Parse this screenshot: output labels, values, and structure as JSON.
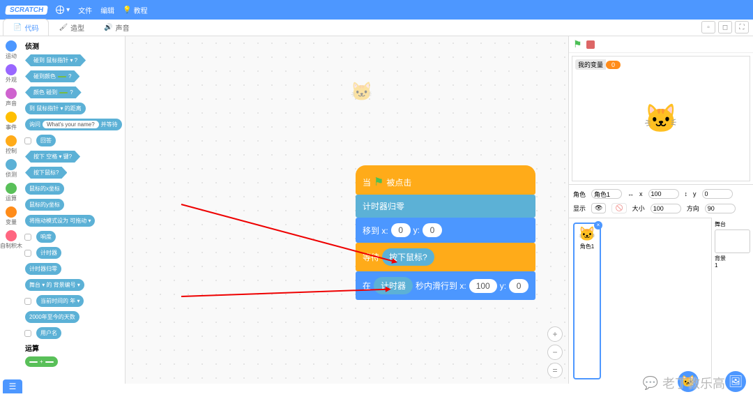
{
  "menu": {
    "file": "文件",
    "edit": "编辑",
    "tutorial": "教程",
    "lang_icon": "globe",
    "bulb": "💡"
  },
  "tabs": {
    "code": "代码",
    "costume": "造型",
    "sound": "声音"
  },
  "categories": [
    {
      "name": "运动",
      "color": "#4c97ff"
    },
    {
      "name": "外观",
      "color": "#9966ff"
    },
    {
      "name": "声音",
      "color": "#cf63cf"
    },
    {
      "name": "事件",
      "color": "#ffbf00"
    },
    {
      "name": "控制",
      "color": "#ffab19"
    },
    {
      "name": "侦测",
      "color": "#5cb1d6"
    },
    {
      "name": "运算",
      "color": "#59c059"
    },
    {
      "name": "变量",
      "color": "#ff8c1a"
    },
    {
      "name": "自制积木",
      "color": "#ff6680"
    }
  ],
  "palette_title": "侦测",
  "palette": {
    "touching": "碰到 鼠标指针 ▾ ?",
    "touching_color": "碰到颜色",
    "color_touching": "颜色       碰到",
    "distance": "到 鼠标指针 ▾ 的距离",
    "ask": "询问",
    "ask_q": "What's your name?",
    "ask_wait": "并等待",
    "answer": "回答",
    "keypressed": "按下 空格 ▾ 键?",
    "mousedown": "按下鼠标?",
    "mousex": "鼠标的x坐标",
    "mousey": "鼠标的y坐标",
    "dragmode": "将拖动模式设为 可拖动 ▾",
    "loudness": "响度",
    "timer": "计时器",
    "reset_timer": "计时器归零",
    "of": "舞台 ▾ 的 背景编号 ▾",
    "current": "当前时间的 年 ▾",
    "days2000": "2000年至今的天数",
    "username": "用户名"
  },
  "operators_title": "运算",
  "stack": {
    "hat": "当",
    "hat2": "被点击",
    "reset": "计时器归零",
    "goto": "移到 x:",
    "goto_x": "0",
    "goto_y_lbl": "y:",
    "goto_y": "0",
    "wait": "等待",
    "mouse_down": "按下鼠标?",
    "glide_in": "在",
    "glide_timer": "计时器",
    "glide_sec": "秒内滑行到 x:",
    "glide_x": "100",
    "glide_y_lbl": "y:",
    "glide_y": "0"
  },
  "stage_var": {
    "label": "我的变量",
    "value": "0"
  },
  "sprite_info": {
    "label": "角色",
    "name": "角色1",
    "x_lbl": "x",
    "x": "100",
    "y_lbl": "y",
    "y": "0",
    "show": "显示",
    "size_lbl": "大小",
    "size": "100",
    "dir_lbl": "方向",
    "dir": "90"
  },
  "sprite_card": "角色1",
  "stage_thumb": {
    "title": "舞台",
    "backdrops": "背景",
    "count": "1"
  },
  "watermark": "老丁教乐高"
}
